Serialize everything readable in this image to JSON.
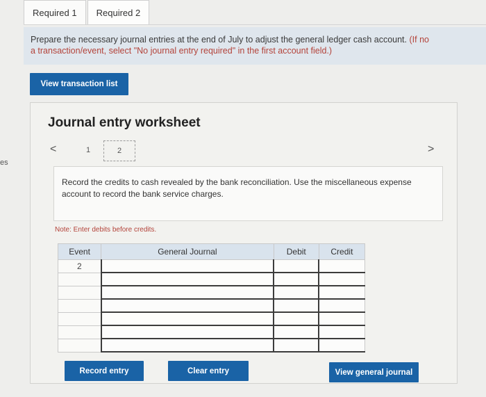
{
  "side_label": "es",
  "tabs": [
    {
      "label": "Required 1"
    },
    {
      "label": "Required 2"
    }
  ],
  "instructions": {
    "text": "Prepare the necessary journal entries at the end of July to adjust the general ledger cash account.",
    "note": "(If no",
    "line2": "a transaction/event, select \"No journal entry required\" in the first account field.)"
  },
  "view_transaction_list": "View transaction list",
  "worksheet": {
    "title": "Journal entry worksheet",
    "pager": {
      "prev": "<",
      "next": ">",
      "pages": [
        "1",
        "2"
      ],
      "current": "2"
    },
    "task_text": "Record the credits to cash revealed by the bank reconciliation. Use the miscellaneous expense account to record the bank service charges.",
    "note": "Note: Enter debits before credits.",
    "table": {
      "headers": [
        "Event",
        "General Journal",
        "Debit",
        "Credit"
      ],
      "rows": [
        {
          "event": "2",
          "general_journal": "",
          "debit": "",
          "credit": ""
        },
        {
          "event": "",
          "general_journal": "",
          "debit": "",
          "credit": ""
        },
        {
          "event": "",
          "general_journal": "",
          "debit": "",
          "credit": ""
        },
        {
          "event": "",
          "general_journal": "",
          "debit": "",
          "credit": ""
        },
        {
          "event": "",
          "general_journal": "",
          "debit": "",
          "credit": ""
        },
        {
          "event": "",
          "general_journal": "",
          "debit": "",
          "credit": ""
        },
        {
          "event": "",
          "general_journal": "",
          "debit": "",
          "credit": ""
        }
      ]
    },
    "buttons": {
      "record": "Record entry",
      "clear": "Clear entry",
      "view_journal": "View general journal"
    }
  },
  "colors": {
    "button_blue": "#1a63a6",
    "note_red": "#b3433a",
    "header_blue": "#d9e3ed"
  }
}
